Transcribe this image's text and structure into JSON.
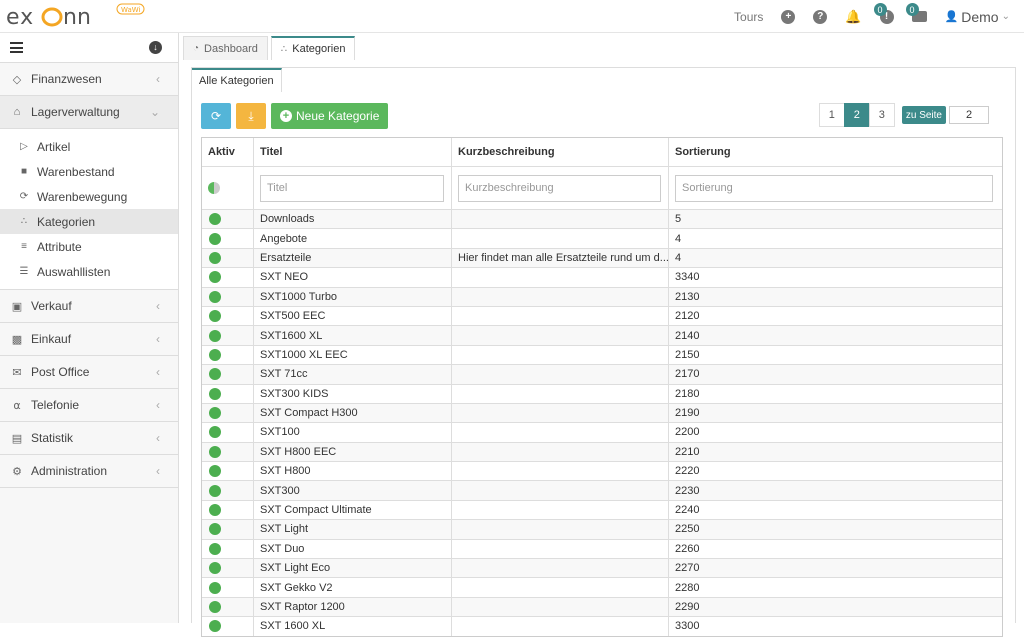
{
  "logo_text": "exonn",
  "logo_badge": "WaWi",
  "topnav": {
    "tours": "Tours",
    "badge1": "0",
    "badge2": "0",
    "user": "Demo"
  },
  "sidebar": {
    "items": [
      {
        "label": "Finanzwesen"
      },
      {
        "label": "Lagerverwaltung"
      },
      {
        "label": "Verkauf"
      },
      {
        "label": "Einkauf"
      },
      {
        "label": "Post Office"
      },
      {
        "label": "Telefonie"
      },
      {
        "label": "Statistik"
      },
      {
        "label": "Administration"
      }
    ],
    "subitems": [
      {
        "label": "Artikel"
      },
      {
        "label": "Warenbestand"
      },
      {
        "label": "Warenbewegung"
      },
      {
        "label": "Kategorien"
      },
      {
        "label": "Attribute"
      },
      {
        "label": "Auswahllisten"
      }
    ]
  },
  "tabs": [
    {
      "label": "Dashboard"
    },
    {
      "label": "Kategorien"
    }
  ],
  "subtab": "Alle Kategorien",
  "toolbar": {
    "new_label": "Neue Kategorie"
  },
  "pager": {
    "pages": [
      "1",
      "2",
      "3"
    ],
    "goto_label": "zu Seite",
    "page_value": "2"
  },
  "table": {
    "headers": [
      "Aktiv",
      "Titel",
      "Kurzbeschreibung",
      "Sortierung"
    ],
    "placeholders": [
      "Titel",
      "Kurzbeschreibung",
      "Sortierung"
    ],
    "rows": [
      {
        "title": "Downloads",
        "desc": "",
        "sort": "5"
      },
      {
        "title": "Angebote",
        "desc": "",
        "sort": "4"
      },
      {
        "title": "Ersatzteile",
        "desc": "Hier findet man alle Ersatzteile rund um d...",
        "sort": "4"
      },
      {
        "title": "SXT NEO",
        "desc": "",
        "sort": "3340"
      },
      {
        "title": "SXT1000 Turbo",
        "desc": "",
        "sort": "2130"
      },
      {
        "title": "SXT500 EEC",
        "desc": "",
        "sort": "2120"
      },
      {
        "title": "SXT1600 XL",
        "desc": "",
        "sort": "2140"
      },
      {
        "title": "SXT1000 XL EEC",
        "desc": "",
        "sort": "2150"
      },
      {
        "title": "SXT 71cc",
        "desc": "",
        "sort": "2170"
      },
      {
        "title": "SXT300 KIDS",
        "desc": "",
        "sort": "2180"
      },
      {
        "title": "SXT Compact H300",
        "desc": "",
        "sort": "2190"
      },
      {
        "title": "SXT100",
        "desc": "",
        "sort": "2200"
      },
      {
        "title": "SXT H800 EEC",
        "desc": "",
        "sort": "2210"
      },
      {
        "title": "SXT H800",
        "desc": "",
        "sort": "2220"
      },
      {
        "title": "SXT300",
        "desc": "",
        "sort": "2230"
      },
      {
        "title": "SXT Compact Ultimate",
        "desc": "",
        "sort": "2240"
      },
      {
        "title": "SXT Light",
        "desc": "",
        "sort": "2250"
      },
      {
        "title": "SXT Duo",
        "desc": "",
        "sort": "2260"
      },
      {
        "title": "SXT Light Eco",
        "desc": "",
        "sort": "2270"
      },
      {
        "title": "SXT Gekko V2",
        "desc": "",
        "sort": "2280"
      },
      {
        "title": "SXT Raptor 1200",
        "desc": "",
        "sort": "2290"
      },
      {
        "title": "SXT 1600 XL",
        "desc": "",
        "sort": "3300"
      }
    ]
  },
  "colors": {
    "accent": "#3c8a8a",
    "active_dot": "#4cae4f",
    "btn_blue": "#54b5d8",
    "btn_orange": "#f4b640",
    "btn_green": "#5bb85d"
  }
}
